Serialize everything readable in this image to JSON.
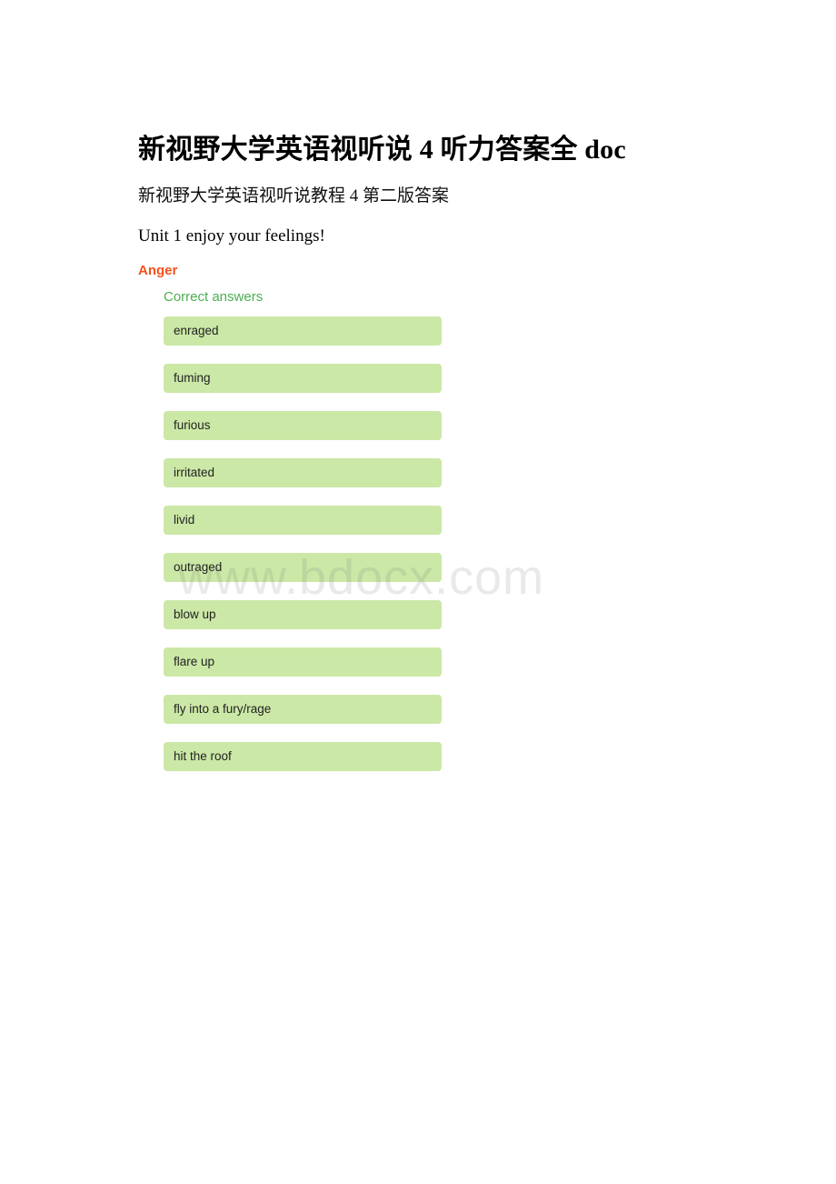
{
  "document": {
    "title": "新视野大学英语视听说 4 听力答案全 doc",
    "subtitle": "新视野大学英语视听说教程 4 第二版答案",
    "unit_heading": "Unit 1 enjoy your feelings!"
  },
  "section": {
    "title": "Anger",
    "title_color": "#f4511e",
    "answers_label": "Correct answers",
    "answers_label_color": "#4caf50",
    "answer_box_color": "#cbe8a6",
    "answers": [
      "enraged",
      "fuming",
      "furious",
      "irritated",
      "livid",
      "outraged",
      "blow up",
      "flare up",
      "fly into a fury/rage",
      "hit the roof"
    ]
  },
  "watermark": {
    "text": "www.bdocx.com",
    "color": "#e3e3e3"
  }
}
